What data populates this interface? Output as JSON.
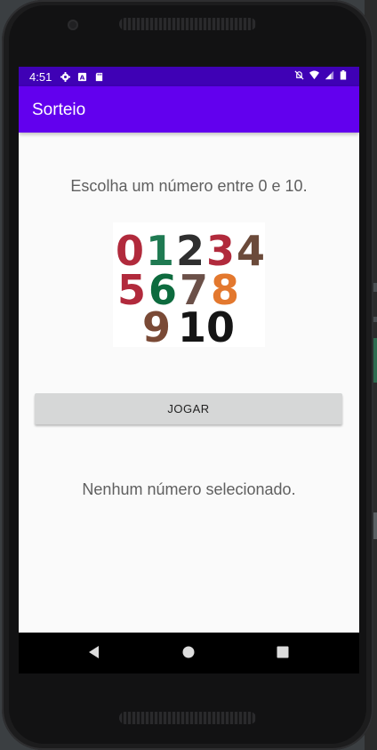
{
  "status_bar": {
    "time": "4:51",
    "left_icons": [
      "gear-icon",
      "a-badge-icon",
      "sd-card-icon"
    ],
    "right_icons": [
      "mute-icon",
      "wifi-icon",
      "signal-icon",
      "battery-icon"
    ],
    "color": "#3f01b5"
  },
  "app_bar": {
    "title": "Sorteio",
    "color": "#6200ee"
  },
  "main": {
    "prompt": "Escolha um número entre 0 e 10.",
    "image": {
      "rows": [
        [
          {
            "d": "0",
            "c": "#b12a3c"
          },
          {
            "d": "1",
            "c": "#1f7a52"
          },
          {
            "d": "2",
            "c": "#2f2f2f"
          },
          {
            "d": "3",
            "c": "#b12a3c"
          },
          {
            "d": "4",
            "c": "#6b4a3a"
          }
        ],
        [
          {
            "d": "5",
            "c": "#b12a3c"
          },
          {
            "d": "6",
            "c": "#0d6b3e"
          },
          {
            "d": "7",
            "c": "#6b5048"
          },
          {
            "d": "8",
            "c": "#e3782e"
          }
        ],
        [
          {
            "d": "9",
            "c": "#7a4a36"
          },
          {
            "d": "10",
            "c": "#151515"
          }
        ]
      ]
    },
    "play_button_label": "JOGAR",
    "result_text": "Nenhum número selecionado."
  },
  "nav_bar": {
    "buttons": [
      "back-icon",
      "home-icon",
      "recents-icon"
    ]
  }
}
